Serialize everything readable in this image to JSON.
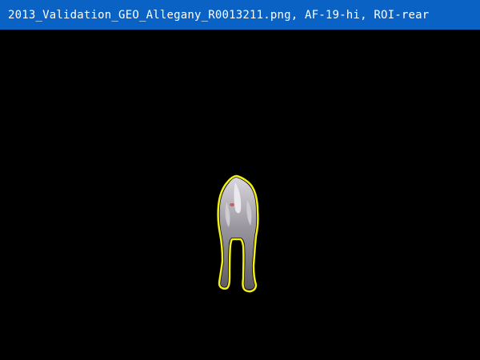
{
  "window": {
    "title": "2013_Validation_GEO_Allegany_R0013211.png, AF-19-hi, ROI-rear"
  },
  "colors": {
    "title_bar_background": "#0a63c4",
    "title_text": "#ffffff",
    "canvas_background": "#000000",
    "roi_outline": "#f2ef16"
  },
  "roi": {
    "label": "ROI-rear",
    "subject": "animal-rear-view"
  }
}
